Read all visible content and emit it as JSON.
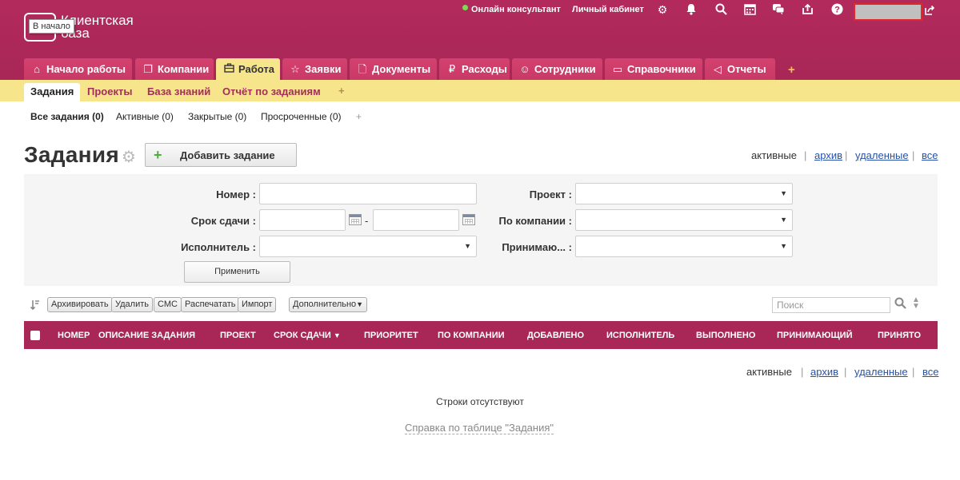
{
  "app": {
    "logo_text": "Клиентская база",
    "tooltip": "В начало"
  },
  "topbar": {
    "online_consultant": "Онлайн консультант",
    "personal_cabinet": "Личный кабинет"
  },
  "main_tabs": [
    {
      "label": "Начало работы",
      "icon": "home-icon"
    },
    {
      "label": "Компании",
      "icon": "companies-icon"
    },
    {
      "label": "Работа",
      "icon": "briefcase-icon",
      "active": true
    },
    {
      "label": "Заявки",
      "icon": "star-icon"
    },
    {
      "label": "Документы",
      "icon": "document-icon"
    },
    {
      "label": "Расходы",
      "icon": "ruble-icon"
    },
    {
      "label": "Сотрудники",
      "icon": "employees-icon"
    },
    {
      "label": "Справочники",
      "icon": "book-icon"
    },
    {
      "label": "Отчеты",
      "icon": "megaphone-icon"
    }
  ],
  "tab_plus": "+",
  "sub_tabs": [
    {
      "label": "Задания",
      "active": true
    },
    {
      "label": "Проекты"
    },
    {
      "label": "База знаний"
    },
    {
      "label": "Отчёт по заданиям"
    }
  ],
  "sub_plus": "+",
  "filters": [
    {
      "label": "Все задания (0)",
      "active": true
    },
    {
      "label": "Активные (0)"
    },
    {
      "label": "Закрытые (0)"
    },
    {
      "label": "Просроченные (0)"
    }
  ],
  "filters_plus": "+",
  "page": {
    "title": "Задания",
    "add_button": "Добавить задание"
  },
  "view_links": {
    "active": "активные",
    "archive": "архив",
    "deleted": "удаленные",
    "all": "все",
    "sep": "|"
  },
  "form": {
    "number_label": "Номер :",
    "due_label": "Срок сдачи :",
    "dash": "-",
    "executor_label": "Исполнитель :",
    "project_label": "Проект :",
    "company_label": "По компании :",
    "accepting_label": "Принимаю... :",
    "apply_button": "Применить"
  },
  "toolbar": {
    "archive": "Архивировать",
    "delete": "Удалить",
    "sms": "СМС",
    "print": "Распечатать",
    "import": "Импорт",
    "more": "Дополнительно",
    "search_placeholder": "Поиск"
  },
  "table": {
    "columns": [
      "НОМЕР",
      "ОПИСАНИЕ ЗАДАНИЯ",
      "ПРОЕКТ",
      "СРОК СДАЧИ",
      "ПРИОРИТЕТ",
      "ПО КОМПАНИИ",
      "ДОБАВЛЕНО",
      "ИСПОЛНИТЕЛЬ",
      "ВЫПОЛНЕНО",
      "ПРИНИМАЮЩИЙ",
      "ПРИНЯТО"
    ],
    "sorted_column": "СРОК СДАЧИ",
    "empty_text": "Строки отсутствуют",
    "help_link": "Справка по таблице \"Задания\""
  },
  "colors": {
    "header": "#a82756",
    "tab": "#d4416f",
    "subbar": "#f7e58c",
    "link": "#2852a8"
  }
}
